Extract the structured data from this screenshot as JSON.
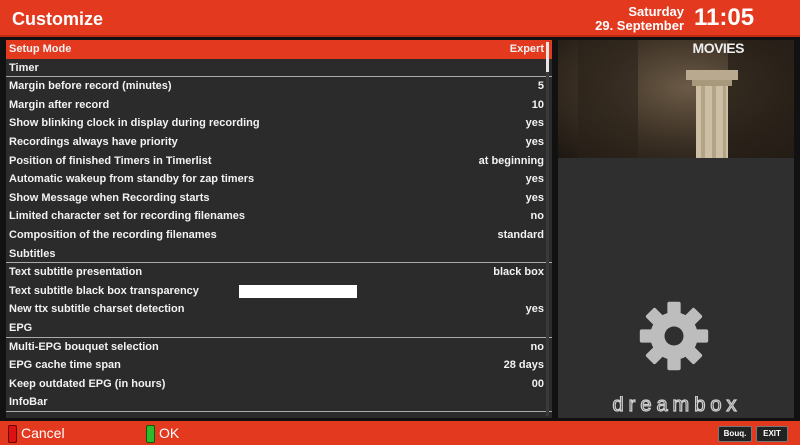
{
  "header": {
    "title": "Customize",
    "day": "Saturday",
    "date": "29. September",
    "time": "11:05"
  },
  "menu": [
    {
      "type": "selected",
      "label": "Setup Mode",
      "value": "Expert"
    },
    {
      "type": "section",
      "label": "Timer",
      "value": ""
    },
    {
      "type": "item",
      "label": "Margin before record (minutes)",
      "value": "5"
    },
    {
      "type": "item",
      "label": "Margin after record",
      "value": "10"
    },
    {
      "type": "item",
      "label": "Show blinking clock in display during recording",
      "value": "yes"
    },
    {
      "type": "item",
      "label": "Recordings always have priority",
      "value": "yes"
    },
    {
      "type": "item",
      "label": "Position of finished Timers in Timerlist",
      "value": "at beginning"
    },
    {
      "type": "item",
      "label": "Automatic wakeup from standby for zap timers",
      "value": "yes"
    },
    {
      "type": "item",
      "label": "Show Message when Recording starts",
      "value": "yes"
    },
    {
      "type": "item",
      "label": "Limited character set for recording filenames",
      "value": "no"
    },
    {
      "type": "item",
      "label": "Composition of the recording filenames",
      "value": "standard"
    },
    {
      "type": "section",
      "label": "Subtitles",
      "value": ""
    },
    {
      "type": "item",
      "label": "Text subtitle presentation",
      "value": "black box"
    },
    {
      "type": "slider",
      "label": "Text subtitle black box transparency",
      "value": ""
    },
    {
      "type": "item",
      "label": "New ttx subtitle charset detection",
      "value": "yes"
    },
    {
      "type": "section",
      "label": "EPG",
      "value": ""
    },
    {
      "type": "item",
      "label": "Multi-EPG bouquet selection",
      "value": "no"
    },
    {
      "type": "item",
      "label": "EPG cache time span",
      "value": "28 days"
    },
    {
      "type": "item",
      "label": "Keep outdated EPG (in hours)",
      "value": "00"
    },
    {
      "type": "section",
      "label": "InfoBar",
      "value": ""
    }
  ],
  "preview": {
    "channel_logo": "MOVIES"
  },
  "brand": {
    "name": "dreambox"
  },
  "footer": {
    "cancel": "Cancel",
    "ok": "OK",
    "bouq": "Bouq.",
    "exit": "EXIT"
  },
  "colors": {
    "accent": "#e3391f",
    "panel": "#2b2b2b",
    "red_key": "#dd1111",
    "green_key": "#2bbb2b"
  },
  "icons": {
    "settings": "gear-icon"
  }
}
